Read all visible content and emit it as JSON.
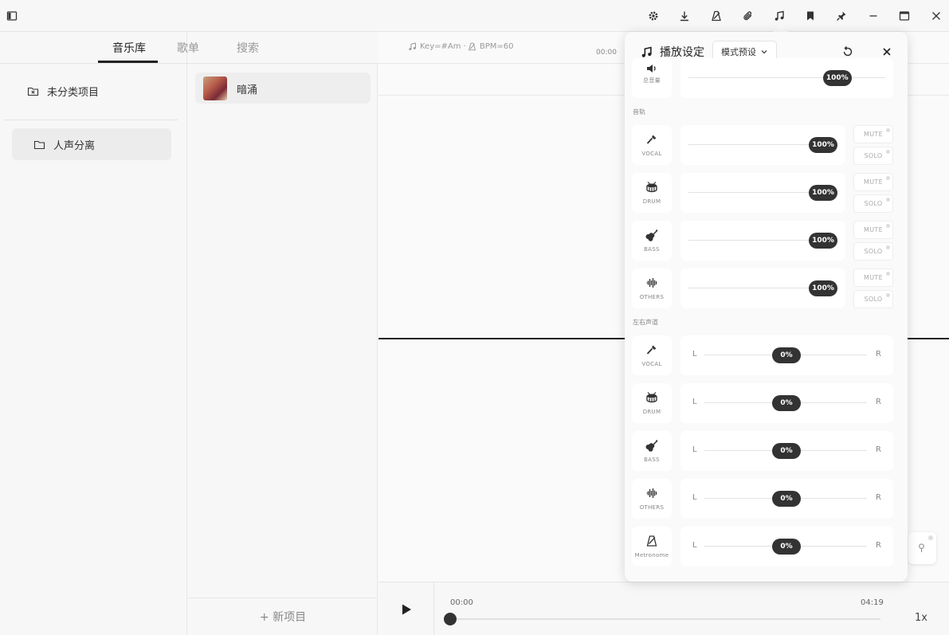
{
  "titlebar": {
    "icons": [
      "sidebar-toggle-icon",
      "settings-icon",
      "download-icon",
      "metronome-icon",
      "attachment-icon",
      "music-note-icon",
      "bookmark-icon",
      "pin-icon",
      "minimize-icon",
      "maximize-icon",
      "close-icon"
    ]
  },
  "library": {
    "tabs": [
      {
        "label": "音乐库",
        "active": true
      },
      {
        "label": "歌单",
        "active": false
      },
      {
        "label": "搜索",
        "active": false
      }
    ],
    "folders": [
      {
        "label": "未分类项目",
        "icon": "folder-x-icon"
      },
      {
        "label": "人声分离",
        "icon": "folder-icon",
        "selected": true
      }
    ],
    "songs": [
      {
        "title": "暗涌"
      }
    ],
    "new_project_label": "+ 新项目"
  },
  "editor": {
    "key_info": "Key=#Am · ",
    "bpm_info": "BPM=60",
    "ruler_start": "00:00"
  },
  "player": {
    "current_time": "00:00",
    "total_time": "04:19",
    "progress": 0,
    "speed": "1x"
  },
  "playback_panel": {
    "title": "播放设定",
    "preset_label": "模式预设",
    "master": {
      "label": "总音量",
      "value": "100%",
      "level": 0.8
    },
    "tracks_section": "音轨",
    "tracks": [
      {
        "name": "VOCAL",
        "icon": "microphone-icon",
        "value": "100%",
        "level": 1.0,
        "mute": "MUTE",
        "solo": "SOLO"
      },
      {
        "name": "DRUM",
        "icon": "drum-icon",
        "value": "100%",
        "level": 1.0,
        "mute": "MUTE",
        "solo": "SOLO"
      },
      {
        "name": "BASS",
        "icon": "guitar-icon",
        "value": "100%",
        "level": 1.0,
        "mute": "MUTE",
        "solo": "SOLO"
      },
      {
        "name": "OTHERS",
        "icon": "waveform-icon",
        "value": "100%",
        "level": 1.0,
        "mute": "MUTE",
        "solo": "SOLO"
      }
    ],
    "pan_section": "左右声道",
    "pan": [
      {
        "name": "VOCAL",
        "icon": "microphone-icon",
        "value": "0%",
        "left": "L",
        "right": "R"
      },
      {
        "name": "DRUM",
        "icon": "drum-icon",
        "value": "0%",
        "left": "L",
        "right": "R"
      },
      {
        "name": "BASS",
        "icon": "guitar-icon",
        "value": "0%",
        "left": "L",
        "right": "R"
      },
      {
        "name": "OTHERS",
        "icon": "waveform-icon",
        "value": "0%",
        "left": "L",
        "right": "R"
      },
      {
        "name": "Metronome",
        "icon": "metronome-icon",
        "value": "0%",
        "left": "L",
        "right": "R"
      }
    ]
  }
}
